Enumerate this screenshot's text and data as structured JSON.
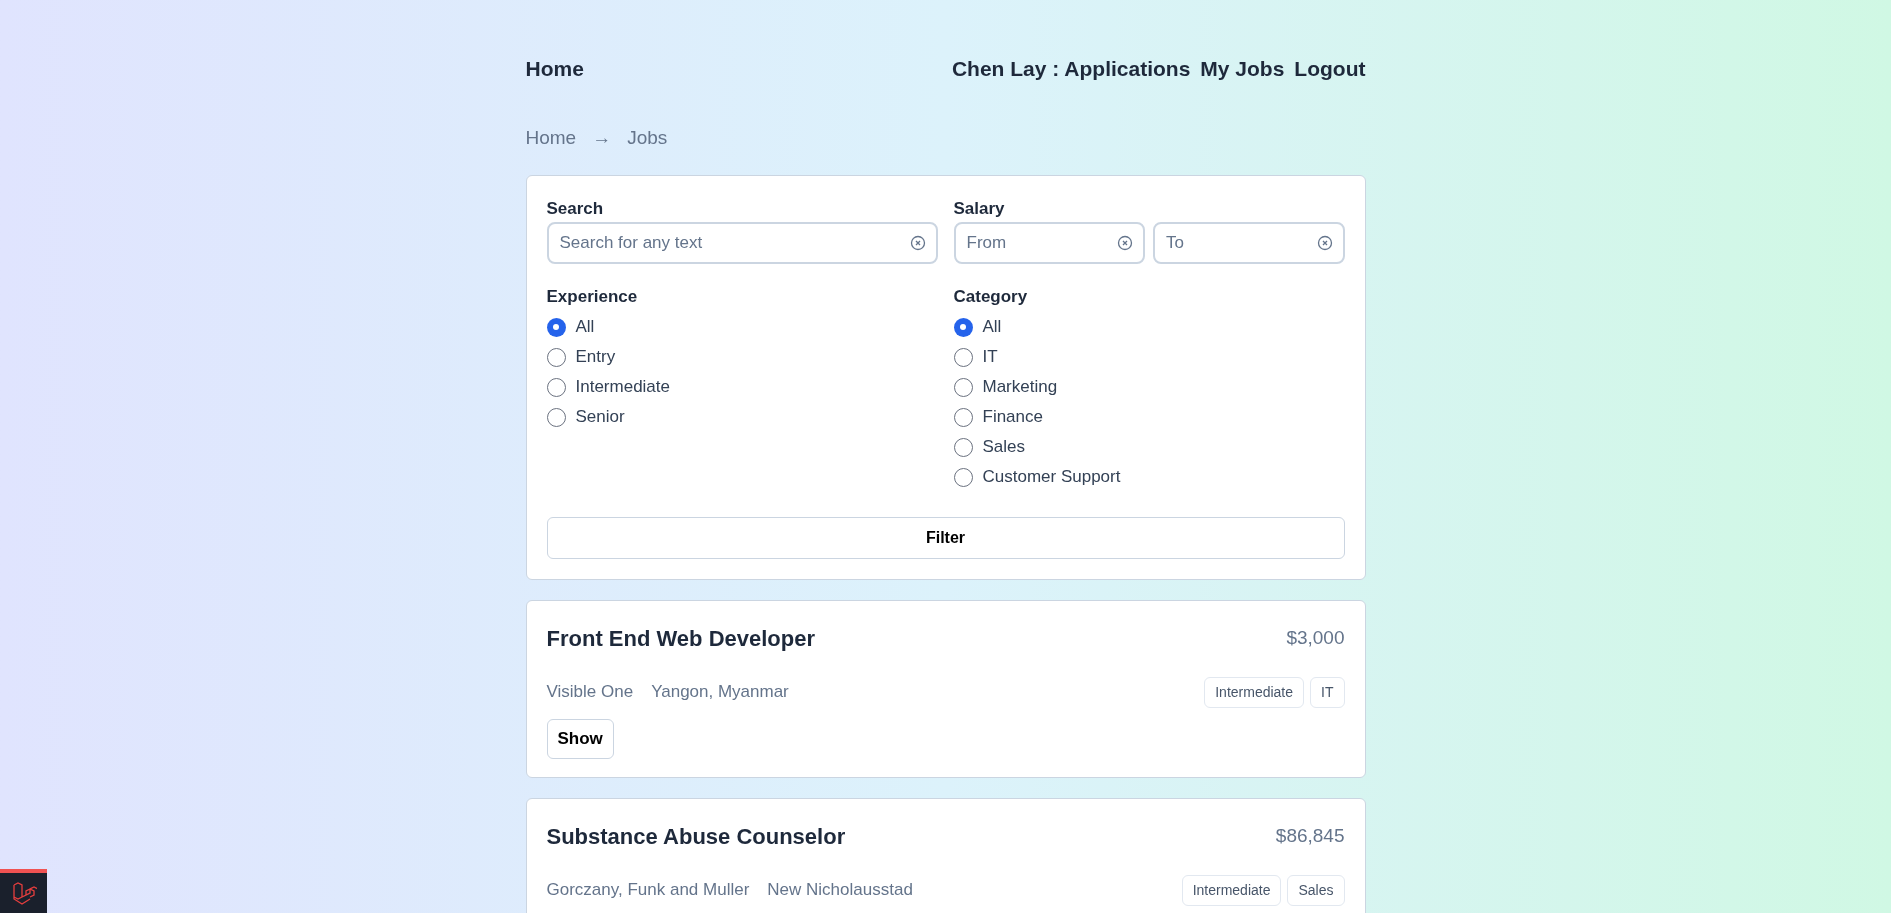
{
  "nav": {
    "home": "Home",
    "links": [
      "Chen Lay : Applications",
      "My Jobs",
      "Logout"
    ]
  },
  "breadcrumb": {
    "items": [
      "Home",
      "Jobs"
    ],
    "separator": "→"
  },
  "filter": {
    "search": {
      "label": "Search",
      "placeholder": "Search for any text"
    },
    "salary": {
      "label": "Salary",
      "fields": [
        {
          "placeholder": "From"
        },
        {
          "placeholder": "To"
        }
      ]
    },
    "experience": {
      "label": "Experience",
      "options": [
        {
          "label": "All",
          "selected": true
        },
        {
          "label": "Entry",
          "selected": false
        },
        {
          "label": "Intermediate",
          "selected": false
        },
        {
          "label": "Senior",
          "selected": false
        }
      ]
    },
    "category": {
      "label": "Category",
      "options": [
        {
          "label": "All",
          "selected": true
        },
        {
          "label": "IT",
          "selected": false
        },
        {
          "label": "Marketing",
          "selected": false
        },
        {
          "label": "Finance",
          "selected": false
        },
        {
          "label": "Sales",
          "selected": false
        },
        {
          "label": "Customer Support",
          "selected": false
        }
      ]
    },
    "button": "Filter"
  },
  "jobs": [
    {
      "title": "Front End Web Developer",
      "salary": "$3,000",
      "company": "Visible One",
      "location": "Yangon, Myanmar",
      "tags": [
        "Intermediate",
        "IT"
      ],
      "button": "Show"
    },
    {
      "title": "Substance Abuse Counselor",
      "salary": "$86,845",
      "company": "Gorczany, Funk and Muller",
      "location": "New Nicholausstad",
      "tags": [
        "Intermediate",
        "Sales"
      ]
    }
  ]
}
